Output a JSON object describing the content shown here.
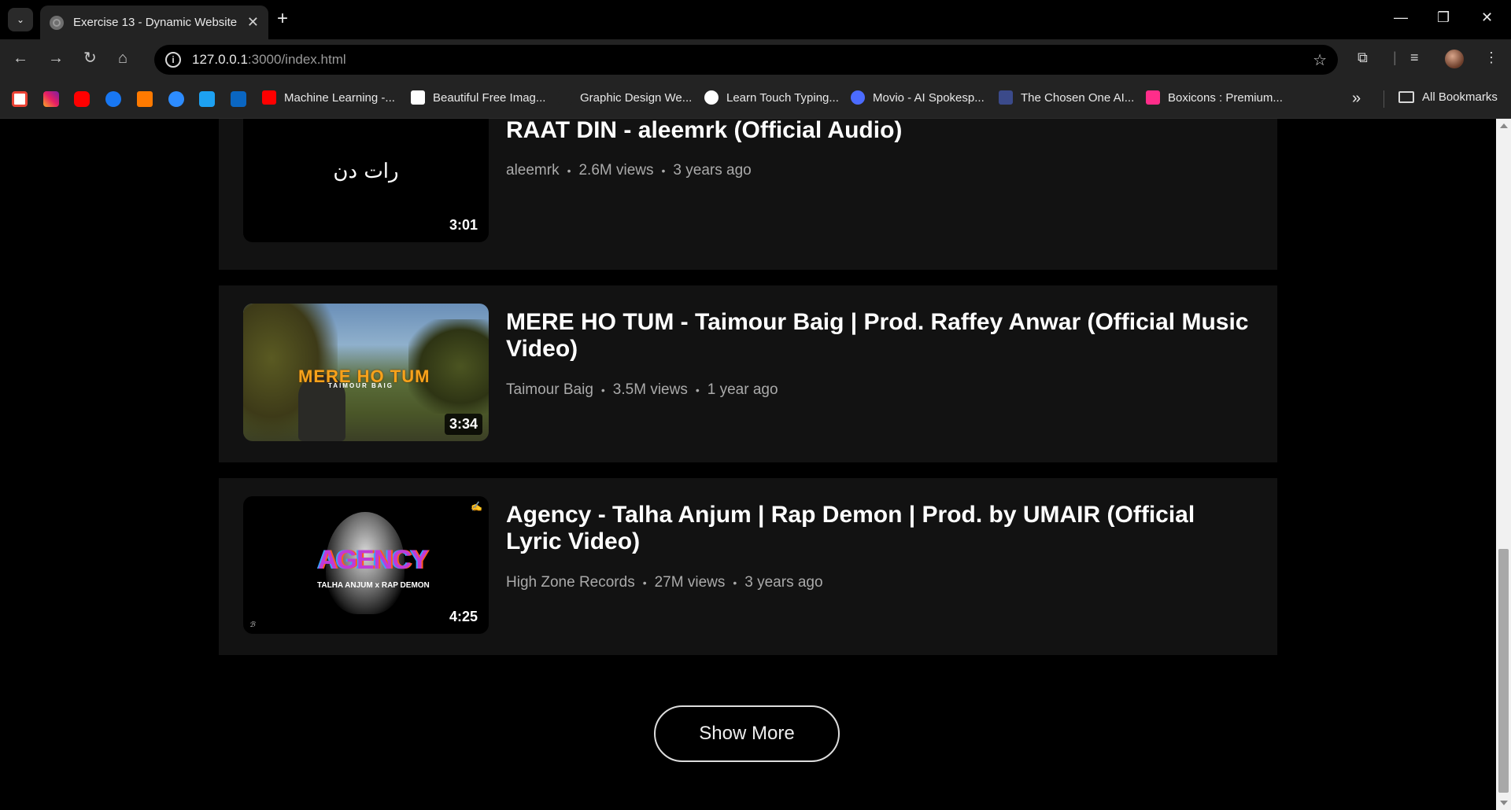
{
  "browser": {
    "tab_title": "Exercise 13 - Dynamic Website",
    "url_host": "127.0.0.1",
    "url_path": ":3000/index.html"
  },
  "bookmarks": {
    "items": [
      {
        "label": "Machine Learning -...",
        "color": "#ff0000"
      },
      {
        "label": "Beautiful Free Imag...",
        "color": "#ffffff"
      },
      {
        "label": "Graphic Design We...",
        "color": "#232323"
      },
      {
        "label": "Learn Touch Typing...",
        "color": "#ffffff"
      },
      {
        "label": "Movio - AI Spokesp...",
        "color": "#4b6bff"
      },
      {
        "label": "The Chosen One AI...",
        "color": "#3b4a8a"
      },
      {
        "label": "Boxicons : Premium...",
        "color": "#ff2d8a"
      }
    ],
    "all_label": "All Bookmarks"
  },
  "videos": [
    {
      "title": "RAAT DIN - aleemrk (Official Audio)",
      "channel": "aleemrk",
      "views": "2.6M views",
      "age": "3 years ago",
      "duration": "3:01",
      "thumb_text": "رات دن"
    },
    {
      "title": "MERE HO TUM - Taimour Baig | Prod. Raffey Anwar (Official Music Video)",
      "channel": "Taimour Baig",
      "views": "3.5M views",
      "age": "1 year ago",
      "duration": "3:34",
      "thumb_text": "MERE HO TUM",
      "thumb_sub": "TAIMOUR BAIG"
    },
    {
      "title": "Agency - Talha Anjum | Rap Demon | Prod. by UMAIR (Official Lyric Video)",
      "channel": "High Zone Records",
      "views": "27M views",
      "age": "3 years ago",
      "duration": "4:25",
      "thumb_text": "AGENCY",
      "thumb_sub": "TALHA ANJUM x RAP DEMON"
    }
  ],
  "show_more_label": "Show More"
}
